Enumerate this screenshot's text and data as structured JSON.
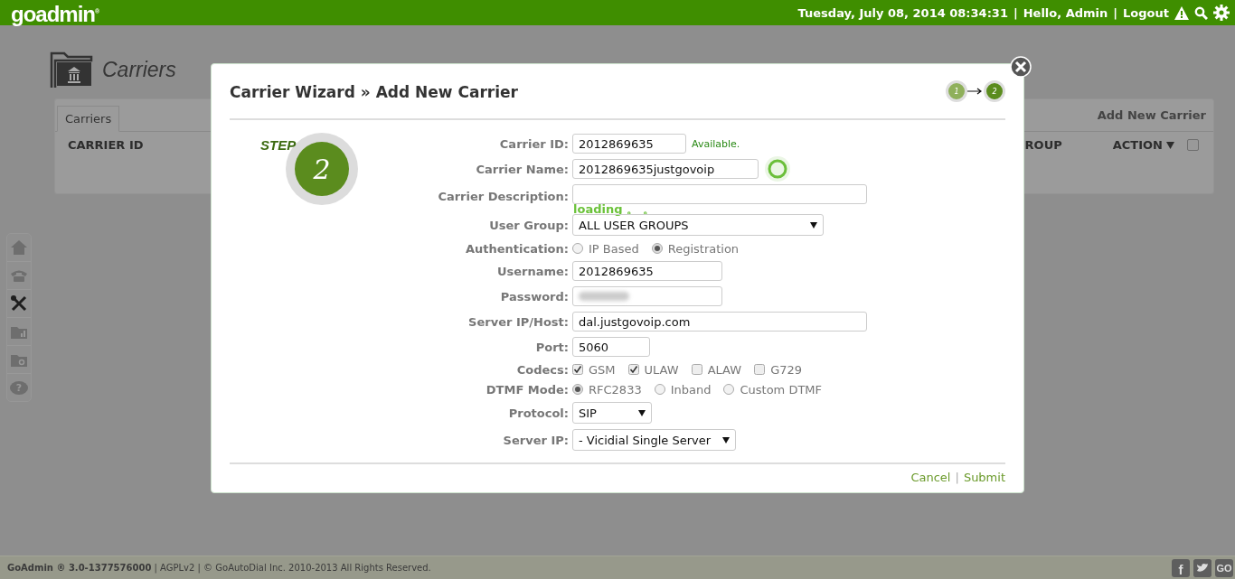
{
  "header": {
    "logo": "goadmin",
    "logo_mark": "®",
    "items": [
      {
        "kind": "text",
        "text": "Tuesday, July 08, 2014 08:34:31"
      },
      {
        "kind": "sep",
        "text": "|"
      },
      {
        "kind": "text",
        "text": "Hello, Admin"
      },
      {
        "kind": "sep",
        "text": "|"
      },
      {
        "kind": "link",
        "text": "Logout"
      },
      {
        "kind": "warning"
      },
      {
        "kind": "search"
      },
      {
        "kind": "settings"
      }
    ]
  },
  "sidebar": {
    "items": [
      {
        "kind": "home",
        "selected": false
      },
      {
        "kind": "phone",
        "selected": false
      },
      {
        "kind": "tools",
        "selected": true
      },
      {
        "kind": "folder-chart",
        "selected": false
      },
      {
        "kind": "folder-search",
        "selected": false
      },
      {
        "kind": "help",
        "text": "?",
        "selected": false
      }
    ]
  },
  "page": {
    "title": "Carriers",
    "tabs": [
      {
        "label": "Carriers",
        "selected": true
      }
    ],
    "add_link": "Add New Carrier",
    "columns": [
      {
        "label": "CARRIER ID"
      },
      {
        "label": "ROUP"
      },
      {
        "label": "ACTION",
        "kind": "dropdown"
      }
    ],
    "select_all": {
      "checked": false
    }
  },
  "modal": {
    "title": "Carrier Wizard » Add New Carrier",
    "steps": [
      {
        "label": "1",
        "selected": false
      },
      {
        "label": "2",
        "selected": true
      }
    ],
    "step_badge": {
      "caption": "STEP",
      "number": "2"
    },
    "fields": [
      {
        "label": "Carrier ID:",
        "kind": "text",
        "value": "2012869635",
        "note": "Available."
      },
      {
        "label": "Carrier Name:",
        "kind": "text",
        "value": "2012869635justgovoip",
        "loading": true
      },
      {
        "label": "Carrier Description:",
        "kind": "text",
        "status": "loading 。 。"
      },
      {
        "label": "User Group:",
        "kind": "select",
        "value": "ALL USER GROUPS"
      },
      {
        "label": "Authentication:",
        "kind": "radio",
        "options": [
          {
            "label": "IP Based",
            "selected": false
          },
          {
            "label": "Registration",
            "selected": true
          }
        ]
      },
      {
        "label": "Username:",
        "kind": "text",
        "value": "2012869635"
      },
      {
        "label": "Password:",
        "kind": "password"
      },
      {
        "label": "Server IP/Host:",
        "kind": "text",
        "value": "dal.justgovoip.com"
      },
      {
        "label": "Port:",
        "kind": "text",
        "value": "5060"
      },
      {
        "label": "Codecs:",
        "kind": "checks",
        "options": [
          {
            "label": "GSM",
            "checked": true
          },
          {
            "label": "ULAW",
            "checked": true
          },
          {
            "label": "ALAW",
            "checked": false
          },
          {
            "label": "G729",
            "checked": false
          }
        ]
      },
      {
        "label": "DTMF Mode:",
        "kind": "radio",
        "options": [
          {
            "label": "RFC2833",
            "selected": true
          },
          {
            "label": "Inband",
            "selected": false
          },
          {
            "label": "Custom DTMF",
            "selected": false
          }
        ]
      },
      {
        "label": "Protocol:",
        "kind": "select",
        "value": "SIP"
      },
      {
        "label": "Server IP:",
        "kind": "select",
        "value": "- Vicidial Single Server"
      }
    ],
    "actions": [
      {
        "kind": "link",
        "text": "Cancel"
      },
      {
        "kind": "sep",
        "text": "|"
      },
      {
        "kind": "link",
        "text": "Submit"
      }
    ]
  },
  "footer": {
    "text": "**GoAdmin ® 3.0-1377576000** | AGPLv2 | © GoAutoDial Inc. 2010-2013 All Rights Reserved.",
    "social": [
      {
        "kind": "facebook",
        "text": "f"
      },
      {
        "kind": "twitter"
      },
      {
        "kind": "go",
        "text": "GO"
      }
    ]
  }
}
